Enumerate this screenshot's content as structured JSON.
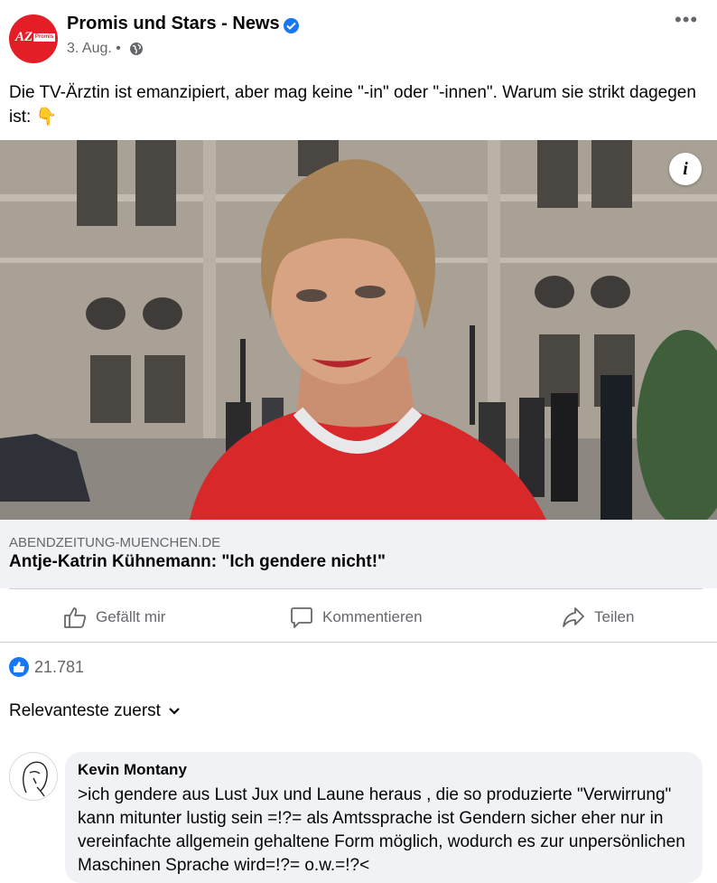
{
  "post": {
    "page_name": "Promis und Stars - News",
    "date": "3. Aug. •",
    "text": "Die TV-Ärztin ist emanzipiert, aber mag keine \"-in\" oder \"-innen\". Warum sie strikt dagegen ist: 👇",
    "logo_text": "AZ",
    "logo_badge": "Promis"
  },
  "link": {
    "domain": "ABENDZEITUNG-MUENCHEN.DE",
    "title": "Antje-Katrin Kühnemann: \"Ich gendere nicht!\""
  },
  "actions": {
    "like": "Gefällt mir",
    "comment": "Kommentieren",
    "share": "Teilen"
  },
  "reactions": {
    "count": "21.781"
  },
  "comments_sort": {
    "label": "Relevanteste zuerst"
  },
  "comment": {
    "author": "Kevin Montany",
    "text": ">ich gendere aus Lust Jux und Laune heraus , die so produzierte \"Verwirrung\" kann mitunter lustig sein =!?= als Amtssprache ist Gendern sicher eher nur in vereinfachte allgemein gehaltene Form möglich, wodurch es zur unpersönlichen Maschinen Sprache wird=!?=  o.w.=!?<"
  },
  "colors": {
    "brand_blue": "#1877f2",
    "logo_red": "#e41e26",
    "dress_red": "#d9282a"
  }
}
